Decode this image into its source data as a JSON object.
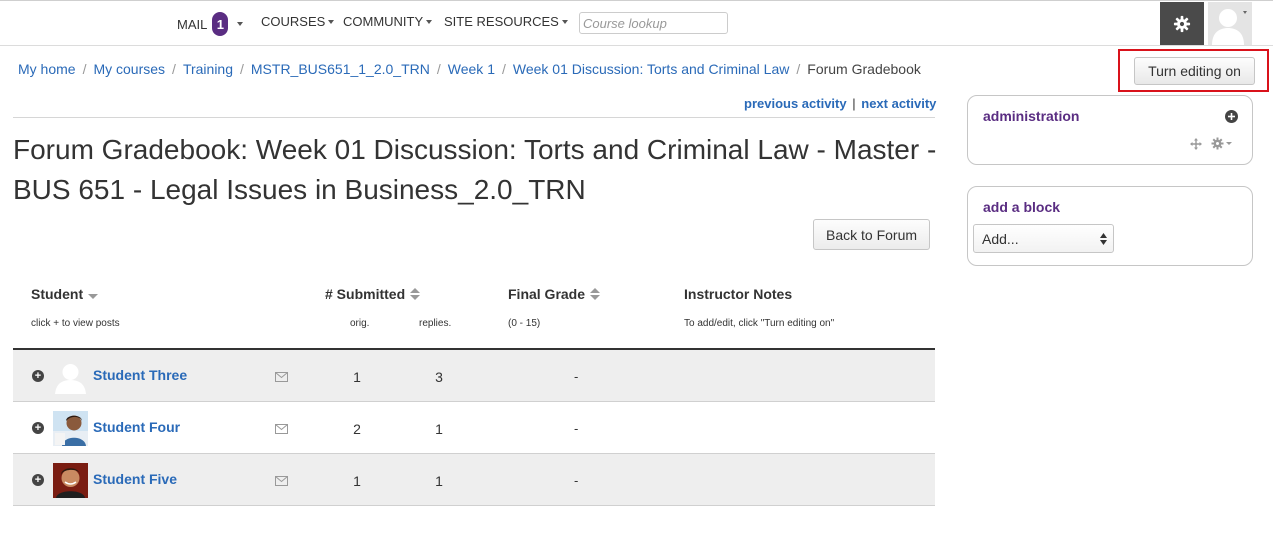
{
  "nav": {
    "mail_label": "MAIL",
    "mail_count": "1",
    "courses_label": "COURSES",
    "community_label": "COMMUNITY",
    "site_resources_label": "SITE RESOURCES",
    "search_placeholder": "Course lookup"
  },
  "breadcrumb": {
    "items": [
      "My home",
      "My courses",
      "Training",
      "MSTR_BUS651_1_2.0_TRN",
      "Week 1",
      "Week 01 Discussion: Torts and Criminal Law"
    ],
    "current": "Forum Gradebook"
  },
  "turn_editing_label": "Turn editing on",
  "activity_nav": {
    "previous": "previous activity",
    "separator": "|",
    "next": "next activity"
  },
  "page_title": "Forum Gradebook: Week 01 Discussion: Torts and Criminal Law - Master - BUS 651 - Legal Issues in Business_2.0_TRN",
  "back_button": "Back to Forum",
  "table": {
    "headers": {
      "student": "Student",
      "submitted": "# Submitted",
      "final_grade": "Final Grade",
      "instructor_notes": "Instructor Notes"
    },
    "subheaders": {
      "student": "click + to view posts",
      "orig": "orig.",
      "replies": "replies.",
      "grade_range": "(0 - 15)",
      "notes": "To add/edit, click \"Turn editing on\""
    },
    "rows": [
      {
        "name": "Student Three",
        "orig": "1",
        "replies": "3",
        "grade": "-"
      },
      {
        "name": "Student Four",
        "orig": "2",
        "replies": "1",
        "grade": "-"
      },
      {
        "name": "Student Five",
        "orig": "1",
        "replies": "1",
        "grade": "-"
      }
    ]
  },
  "blocks": {
    "administration": {
      "title": "administration"
    },
    "add_block": {
      "title": "add a block",
      "select_value": "Add..."
    }
  },
  "colors": {
    "link": "#2a6ab8",
    "brand_purple": "#5a2d82",
    "highlight_red": "#d9121b"
  },
  "icons": [
    "chevron-down-icon",
    "gear-icon",
    "user-avatar",
    "sort-icon",
    "expand-plus-icon",
    "envelope-icon",
    "move-icon",
    "add-plus-icon"
  ]
}
